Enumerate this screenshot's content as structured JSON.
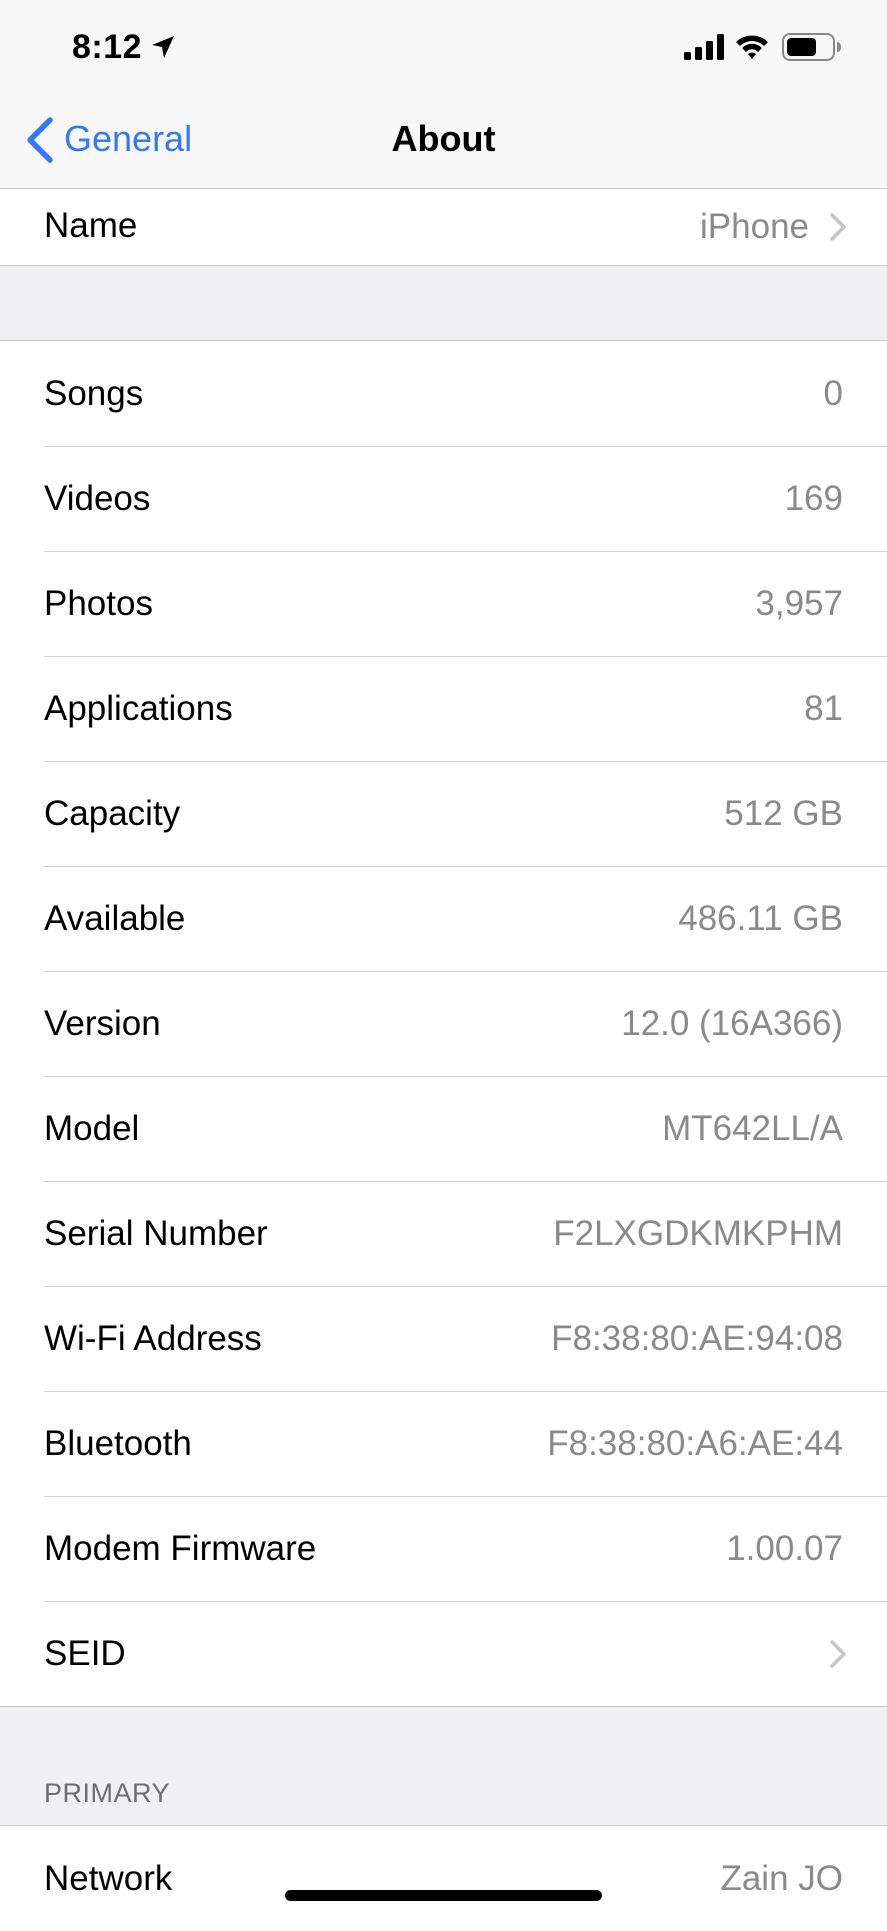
{
  "status_bar": {
    "time": "8:12",
    "icons": [
      "location-arrow-icon",
      "cellular-signal-icon",
      "wifi-icon",
      "battery-icon"
    ]
  },
  "nav": {
    "back_label": "General",
    "title": "About"
  },
  "name_row": {
    "label": "Name",
    "value": "iPhone"
  },
  "info_rows": [
    {
      "label": "Songs",
      "value": "0"
    },
    {
      "label": "Videos",
      "value": "169"
    },
    {
      "label": "Photos",
      "value": "3,957"
    },
    {
      "label": "Applications",
      "value": "81"
    },
    {
      "label": "Capacity",
      "value": "512 GB"
    },
    {
      "label": "Available",
      "value": "486.11 GB"
    },
    {
      "label": "Version",
      "value": "12.0 (16A366)"
    },
    {
      "label": "Model",
      "value": "MT642LL/A"
    },
    {
      "label": "Serial Number",
      "value": "F2LXGDKMKPHM"
    },
    {
      "label": "Wi-Fi Address",
      "value": "F8:38:80:AE:94:08"
    },
    {
      "label": "Bluetooth",
      "value": "F8:38:80:A6:AE:44"
    },
    {
      "label": "Modem Firmware",
      "value": "1.00.07"
    },
    {
      "label": "SEID",
      "value": ""
    }
  ],
  "primary_section": {
    "header": "PRIMARY",
    "rows": [
      {
        "label": "Network",
        "value": "Zain JO"
      }
    ]
  },
  "colors": {
    "accent": "#3478f6",
    "background": "#efeff4",
    "secondary_text": "#8a8a8e",
    "separator": "#c8c7cc"
  }
}
